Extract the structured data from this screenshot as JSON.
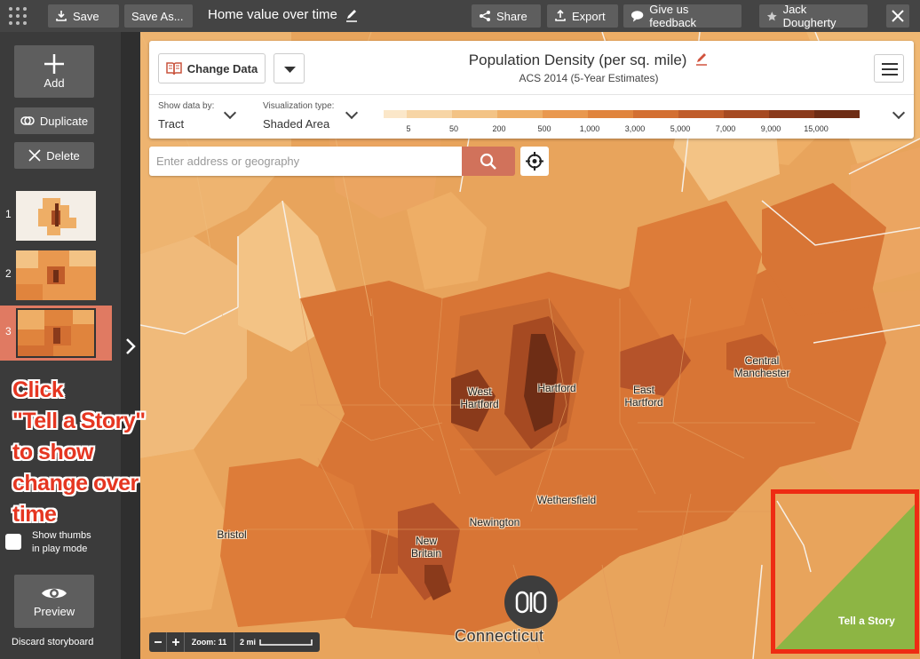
{
  "topbar": {
    "save": "Save",
    "save_as": "Save As...",
    "title": "Home value over time",
    "share": "Share",
    "export": "Export",
    "feedback": "Give us feedback",
    "user": "Jack Dougherty"
  },
  "sidebar": {
    "add": "Add",
    "duplicate": "Duplicate",
    "delete": "Delete",
    "slides": [
      {
        "num": "1"
      },
      {
        "num": "2"
      },
      {
        "num": "3"
      }
    ],
    "selected_slide": 3,
    "show_thumbs": "Show thumbs\nin play mode",
    "preview": "Preview",
    "discard": "Discard storyboard"
  },
  "annotation": {
    "text": "Click\n\"Tell a Story\"\nto show\nchange over\ntime",
    "color": "#e53621"
  },
  "panel": {
    "change_data": "Change Data",
    "title": "Population Density (per sq. mile)",
    "subtitle": "ACS 2014 (5-Year Estimates)",
    "show_data_by_label": "Show data by:",
    "show_data_by_value": "Tract",
    "viz_type_label": "Visualization type:",
    "viz_type_value": "Shaded Area",
    "legend_ticks": [
      "5",
      "50",
      "200",
      "500",
      "1,000",
      "3,000",
      "5,000",
      "7,000",
      "9,000",
      "15,000"
    ],
    "legend_colors": [
      "#fbe7c9",
      "#f7d5a5",
      "#f3c385",
      "#eeae66",
      "#e9984f",
      "#e0843d",
      "#d36f32",
      "#c05c2a",
      "#a64a22",
      "#8a3a1b",
      "#6e2d15"
    ]
  },
  "search": {
    "placeholder": "Enter address or geography"
  },
  "map": {
    "towns": [
      "West Hartford",
      "Hartford",
      "East Hartford",
      "Central Manchester",
      "Wethersfield",
      "Newington",
      "Bristol",
      "New Britain"
    ],
    "state": "Connecticut",
    "zoom_label": "Zoom: 11",
    "scale_label": "2 mi"
  },
  "story": {
    "label": "Tell a Story",
    "highlight_color": "#ee2b13",
    "tile_color": "#8db544"
  }
}
